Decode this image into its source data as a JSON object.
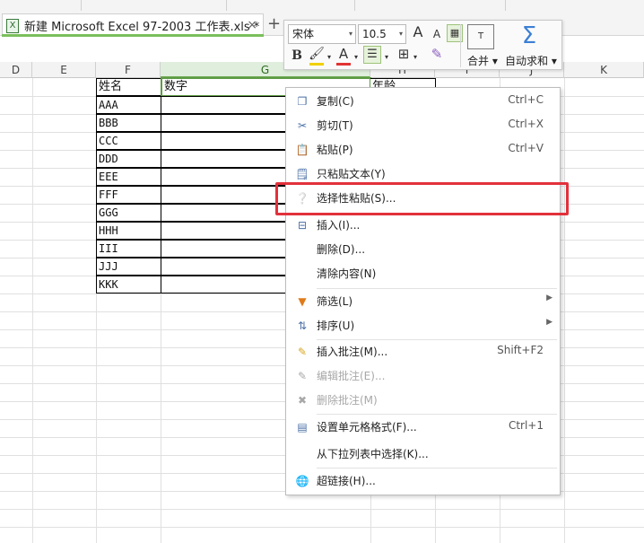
{
  "file_tab": {
    "icon": "excel-file-icon",
    "name": "新建 Microsoft Excel 97-2003 工作表.xls *",
    "close": "×",
    "new_tab": "+"
  },
  "mini_toolbar": {
    "font_name": "宋体",
    "font_size": "10.5",
    "grow_font": "A",
    "shrink_font": "A",
    "bold": "B",
    "font_color_label": "A",
    "merge_label": "合并",
    "autosum_label": "自动求和",
    "sum_symbol": "Σ",
    "dropdown": "▾",
    "colors": {
      "font_color": "#e23232",
      "fill_color": "#f0d000"
    }
  },
  "columns": [
    "D",
    "E",
    "F",
    "G",
    "H",
    "I",
    "J",
    "K"
  ],
  "active_column": "G",
  "table": {
    "headers": [
      "姓名",
      "数字",
      "年龄"
    ],
    "names": [
      "AAA",
      "BBB",
      "CCC",
      "DDD",
      "EEE",
      "FFF",
      "GGG",
      "HHH",
      "III",
      "JJJ",
      "KKK"
    ]
  },
  "context_menu": {
    "items": [
      {
        "label": "复制(C)",
        "shortcut": "Ctrl+C",
        "icon": "copy-icon",
        "enabled": true
      },
      {
        "label": "剪切(T)",
        "shortcut": "Ctrl+X",
        "icon": "scissors-icon",
        "enabled": true
      },
      {
        "label": "粘贴(P)",
        "shortcut": "Ctrl+V",
        "icon": "paste-icon",
        "enabled": true
      },
      {
        "label": "只粘贴文本(Y)",
        "shortcut": "",
        "icon": "paste-text-icon",
        "enabled": true
      },
      {
        "label": "选择性粘贴(S)...",
        "shortcut": "",
        "icon": "paste-special-icon",
        "enabled": true
      },
      {
        "label": "插入(I)...",
        "shortcut": "",
        "icon": "insert-icon",
        "enabled": true
      },
      {
        "label": "删除(D)...",
        "shortcut": "",
        "icon": "",
        "enabled": true
      },
      {
        "label": "清除内容(N)",
        "shortcut": "",
        "icon": "",
        "enabled": true
      },
      {
        "label": "筛选(L)",
        "shortcut": "",
        "icon": "filter-icon",
        "enabled": true,
        "submenu": true
      },
      {
        "label": "排序(U)",
        "shortcut": "",
        "icon": "sort-icon",
        "enabled": true,
        "submenu": true
      },
      {
        "label": "插入批注(M)...",
        "shortcut": "Shift+F2",
        "icon": "insert-comment-icon",
        "enabled": true
      },
      {
        "label": "编辑批注(E)...",
        "shortcut": "",
        "icon": "edit-comment-icon",
        "enabled": false
      },
      {
        "label": "删除批注(M)",
        "shortcut": "",
        "icon": "delete-comment-icon",
        "enabled": false
      },
      {
        "label": "设置单元格格式(F)...",
        "shortcut": "Ctrl+1",
        "icon": "format-cells-icon",
        "enabled": true
      },
      {
        "label": "从下拉列表中选择(K)...",
        "shortcut": "",
        "icon": "",
        "enabled": true
      },
      {
        "label": "超链接(H)...",
        "shortcut": "",
        "icon": "hyperlink-icon",
        "enabled": true
      }
    ],
    "highlighted_item": "选择性粘贴(S)...",
    "highlight_color": "#e2313b"
  }
}
